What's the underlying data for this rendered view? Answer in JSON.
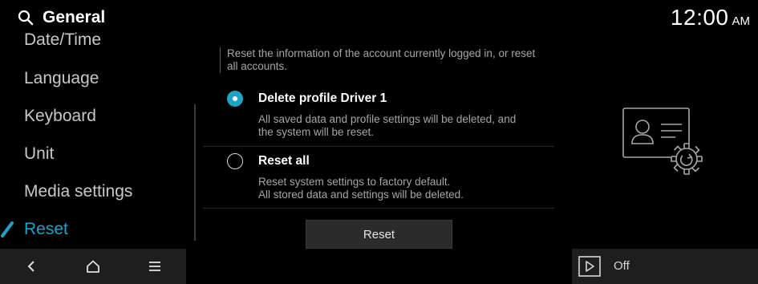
{
  "header": {
    "title": "General",
    "clock_time": "12:00",
    "clock_period": "AM"
  },
  "sidebar": {
    "items": [
      {
        "label": "Date/Time"
      },
      {
        "label": "Language"
      },
      {
        "label": "Keyboard"
      },
      {
        "label": "Unit"
      },
      {
        "label": "Media settings"
      },
      {
        "label": "Reset",
        "active": true
      }
    ]
  },
  "main": {
    "description": "Reset the information of the account currently logged in, or reset all accounts.",
    "options": [
      {
        "title": "Delete profile Driver 1",
        "desc_line1": "All saved data and profile settings will be deleted, and",
        "desc_line2": "the system will be reset.",
        "selected": true
      },
      {
        "title": "Reset all",
        "desc_line1": "Reset system settings to factory default.",
        "desc_line2": "All stored data and settings will be deleted.",
        "selected": false
      }
    ],
    "reset_button_label": "Reset"
  },
  "bottom_nav": {
    "icons": [
      "back-icon",
      "home-icon",
      "menu-icon"
    ]
  },
  "media_widget": {
    "icon": "play-icon",
    "status": "Off"
  },
  "colors": {
    "accent": "#1fa3c4",
    "background": "#000000",
    "panel": "#1e1e1e"
  }
}
